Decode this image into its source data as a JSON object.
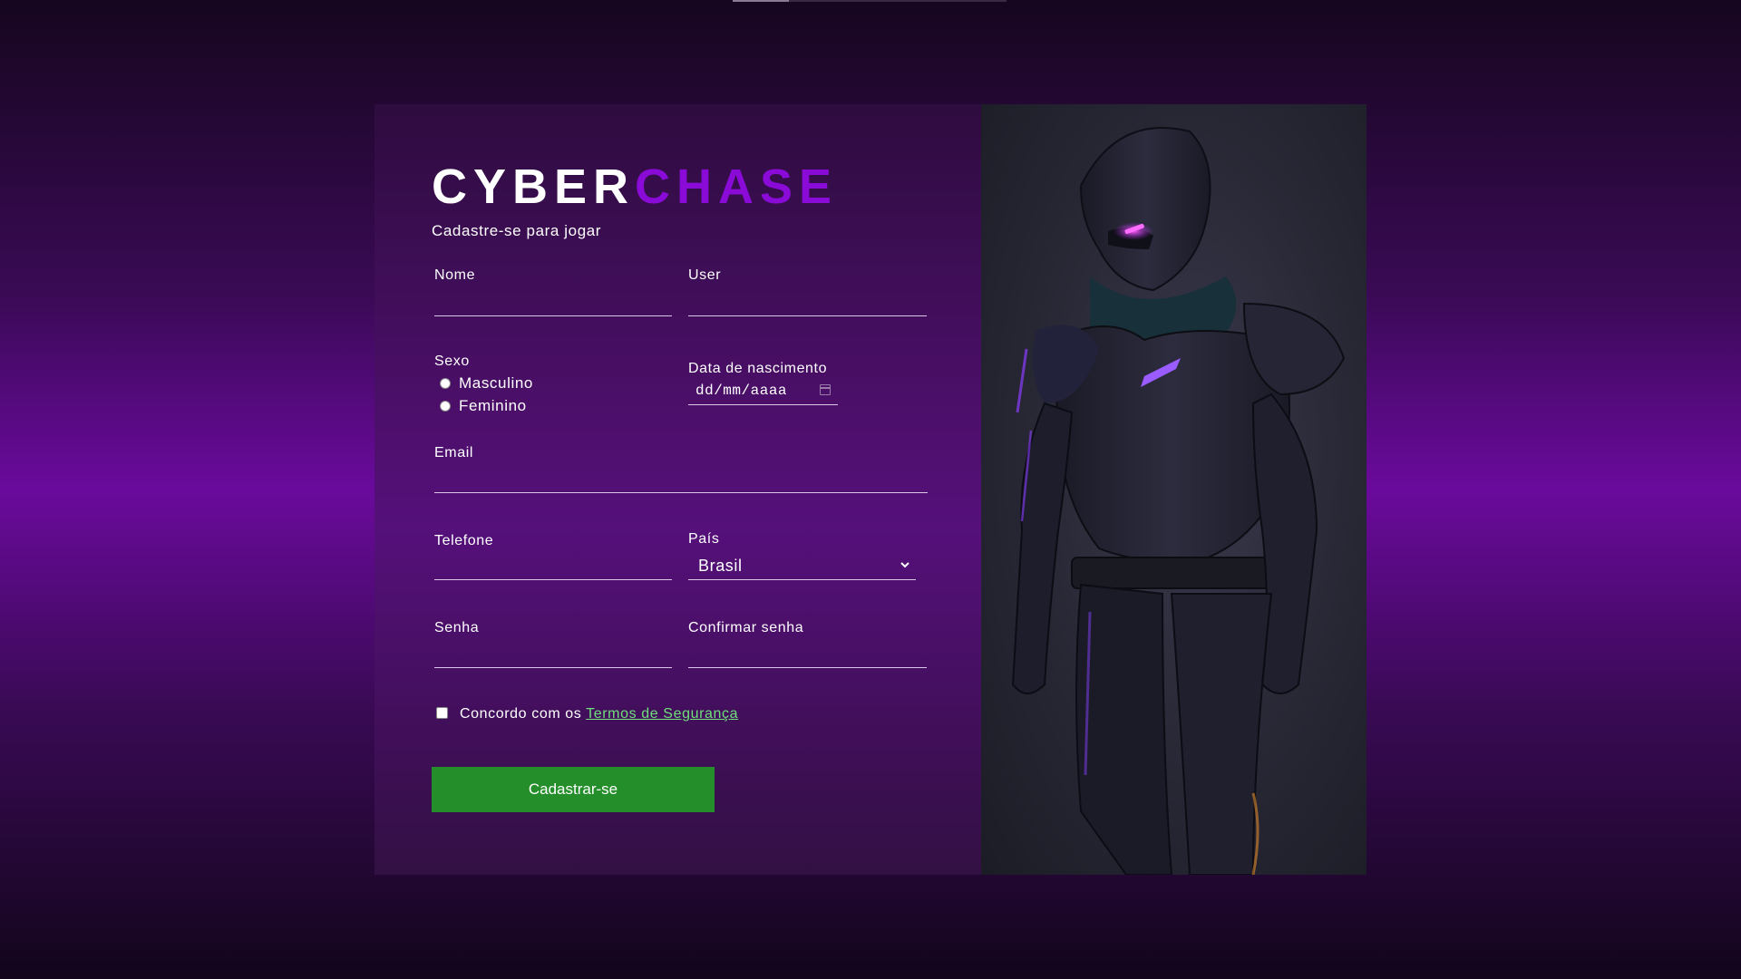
{
  "logo": {
    "part1": "CYBER",
    "part2": "CHASE"
  },
  "subtitle": "Cadastre-se para jogar",
  "form": {
    "nome_label": "Nome",
    "user_label": "User",
    "sexo_label": "Sexo",
    "sexo_options": [
      "Masculino",
      "Feminino"
    ],
    "data_label": "Data de nascimento",
    "data_placeholder": "dd/mm/aaaa",
    "email_label": "Email",
    "telefone_label": "Telefone",
    "pais_label": "País",
    "pais_value": "Brasil",
    "senha_label": "Senha",
    "confirmar_label": "Confirmar senha",
    "terms_text": "Concordo com os",
    "terms_link": "Termos de Segurança",
    "submit_label": "Cadastrar-se"
  },
  "colors": {
    "accent_purple": "#8a0ad8",
    "button_green": "#248f2a",
    "link_green": "#6fe07a"
  },
  "image": {
    "semantic": "cyber-soldier-illustration"
  }
}
